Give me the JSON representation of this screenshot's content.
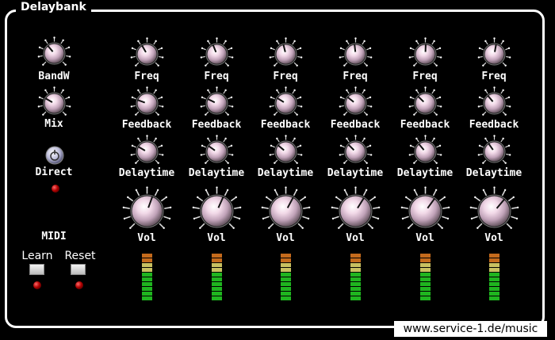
{
  "window": {
    "title": "Delaybank"
  },
  "left_controls": {
    "bandwidth_label": "BandW",
    "mix_label": "Mix",
    "direct_label": "Direct",
    "midi_label": "MIDI",
    "learn_label": "Learn",
    "reset_label": "Reset"
  },
  "channels": [
    {
      "freq_label": "Freq",
      "feedback_label": "Feedback",
      "delaytime_label": "Delaytime",
      "vol_label": "Vol"
    },
    {
      "freq_label": "Freq",
      "feedback_label": "Feedback",
      "delaytime_label": "Delaytime",
      "vol_label": "Vol"
    },
    {
      "freq_label": "Freq",
      "feedback_label": "Feedback",
      "delaytime_label": "Delaytime",
      "vol_label": "Vol"
    },
    {
      "freq_label": "Freq",
      "feedback_label": "Feedback",
      "delaytime_label": "Delaytime",
      "vol_label": "Vol"
    },
    {
      "freq_label": "Freq",
      "feedback_label": "Feedback",
      "delaytime_label": "Delaytime",
      "vol_label": "Vol"
    },
    {
      "freq_label": "Freq",
      "feedback_label": "Feedback",
      "delaytime_label": "Delaytime",
      "vol_label": "Vol"
    }
  ],
  "footer": {
    "url_text": "www.service-1.de/music"
  },
  "colors": {
    "background": "#000000",
    "frame": "#ffffff",
    "led_on": "#cc0000",
    "meter_green": "#1fb51f",
    "meter_amber": "#c8c060",
    "meter_orange": "#c46a1c"
  }
}
